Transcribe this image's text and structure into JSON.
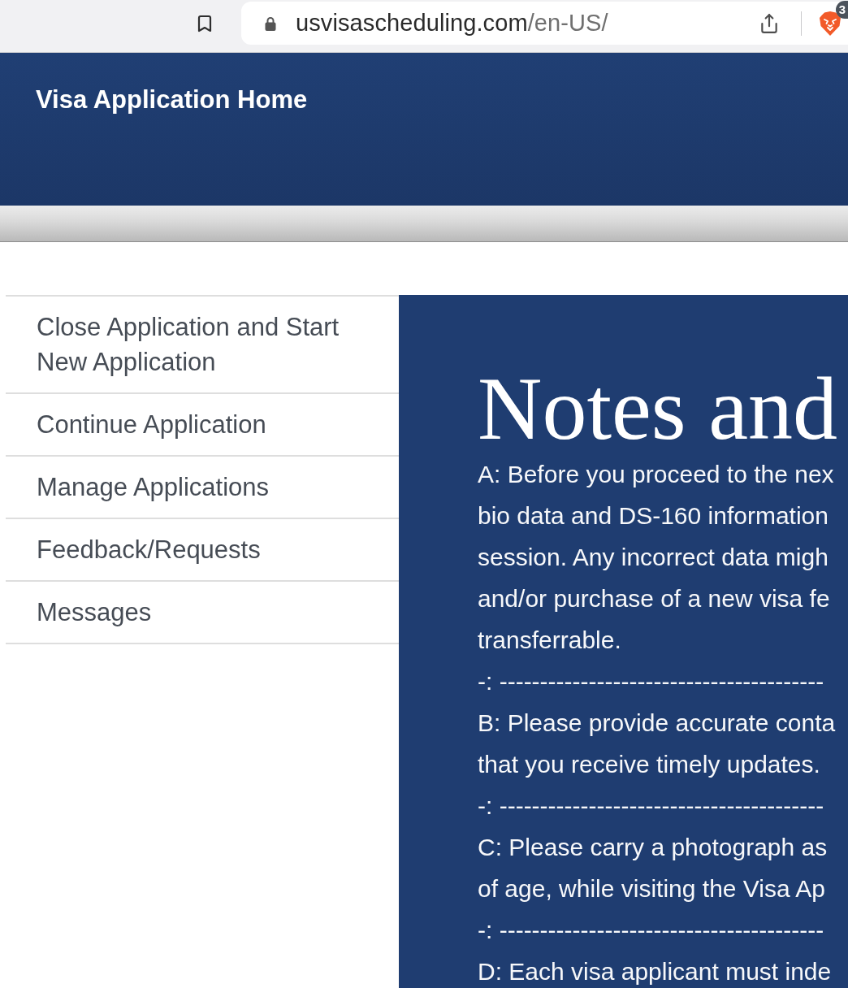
{
  "browser": {
    "url": {
      "host": "usvisascheduling.com",
      "path": "/en-US/"
    },
    "shields_badge": "3"
  },
  "header": {
    "title": "Visa Application Home"
  },
  "sidebar": {
    "items": [
      {
        "label": "Close Application and Start New Application"
      },
      {
        "label": "Continue Application"
      },
      {
        "label": "Manage Applications"
      },
      {
        "label": "Feedback/Requests"
      },
      {
        "label": "Messages"
      }
    ]
  },
  "notes": {
    "title": "Notes and",
    "items": [
      {
        "kind": "paragraph",
        "lines": [
          "A: Before you proceed to the nex",
          "bio data and DS-160 information",
          "session. Any incorrect data migh",
          "and/or purchase of a new visa fe",
          "transferrable."
        ]
      },
      {
        "kind": "divider",
        "text": "-: ----------------------------------------"
      },
      {
        "kind": "paragraph",
        "lines": [
          "B: Please provide accurate conta",
          "that you receive timely updates."
        ]
      },
      {
        "kind": "divider",
        "text": "-: ----------------------------------------"
      },
      {
        "kind": "paragraph",
        "lines": [
          "C: Please carry a photograph as",
          "of age, while visiting the Visa Ap"
        ]
      },
      {
        "kind": "divider",
        "text": "-: ----------------------------------------"
      },
      {
        "kind": "paragraph",
        "lines": [
          "D: Each visa applicant must inde"
        ]
      }
    ]
  }
}
